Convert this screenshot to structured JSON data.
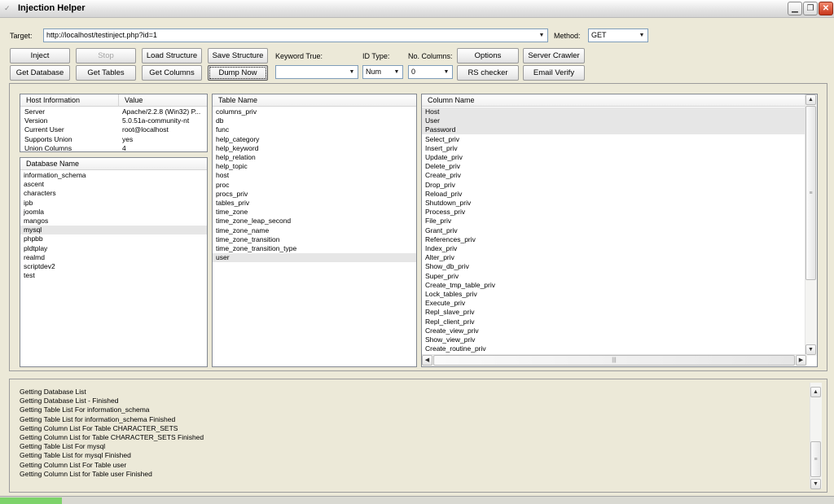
{
  "window": {
    "title": "Injection Helper"
  },
  "toolbar": {
    "target_label": "Target:",
    "target_value": "http://localhost/testinject.php?id=1",
    "method_label": "Method:",
    "method_value": "GET",
    "keyword_true_label": "Keyword True:",
    "keyword_true_value": "",
    "id_type_label": "ID Type:",
    "id_type_value": "Num",
    "no_columns_label": "No. Columns:",
    "no_columns_value": "0",
    "buttons": {
      "inject": "Inject",
      "stop": "Stop",
      "load_structure": "Load Structure",
      "save_structure": "Save Structure",
      "options": "Options",
      "server_crawler": "Server Crawler",
      "get_database": "Get Database",
      "get_tables": "Get Tables",
      "get_columns": "Get Columns",
      "dump_now": "Dump Now",
      "rs_checker": "RS checker",
      "email_verify": "Email Verify"
    }
  },
  "host_info": {
    "headers": [
      "Host Information",
      "Value"
    ],
    "rows": [
      {
        "key": "Server",
        "value": "Apache/2.2.8 (Win32) P..."
      },
      {
        "key": "Version",
        "value": "5.0.51a-community-nt"
      },
      {
        "key": "Current User",
        "value": "root@localhost"
      },
      {
        "key": "Supports Union",
        "value": "yes"
      },
      {
        "key": "Union Columns",
        "value": "4"
      }
    ]
  },
  "databases": {
    "header": "Database Name",
    "items": [
      "information_schema",
      "ascent",
      "characters",
      "ipb",
      "joomla",
      "mangos",
      "mysql",
      "phpbb",
      "pldtplay",
      "realmd",
      "scriptdev2",
      "test"
    ],
    "selected_index": 6
  },
  "tables": {
    "header": "Table Name",
    "items": [
      "columns_priv",
      "db",
      "func",
      "help_category",
      "help_keyword",
      "help_relation",
      "help_topic",
      "host",
      "proc",
      "procs_priv",
      "tables_priv",
      "time_zone",
      "time_zone_leap_second",
      "time_zone_name",
      "time_zone_transition",
      "time_zone_transition_type",
      "user"
    ],
    "selected_index": 16
  },
  "columns": {
    "header": "Column Name",
    "items": [
      "Host",
      "User",
      "Password",
      "Select_priv",
      "Insert_priv",
      "Update_priv",
      "Delete_priv",
      "Create_priv",
      "Drop_priv",
      "Reload_priv",
      "Shutdown_priv",
      "Process_priv",
      "File_priv",
      "Grant_priv",
      "References_priv",
      "Index_priv",
      "Alter_priv",
      "Show_db_priv",
      "Super_priv",
      "Create_tmp_table_priv",
      "Lock_tables_priv",
      "Execute_priv",
      "Repl_slave_priv",
      "Repl_client_priv",
      "Create_view_priv",
      "Show_view_priv",
      "Create_routine_priv"
    ],
    "selected_indices": [
      0,
      1,
      2
    ]
  },
  "log": {
    "lines": [
      "Getting Database List",
      "Getting Database List - Finished",
      "Getting Table List For information_schema",
      "Getting Table List for information_schema Finished",
      "Getting Column List For Table CHARACTER_SETS",
      "Getting Column List for Table CHARACTER_SETS Finished",
      "Getting Table List For mysql",
      "Getting Table List for mysql Finished",
      "Getting Column List For Table user",
      "Getting Column List for Table user Finished"
    ]
  },
  "icons": {
    "title": "app-icon",
    "minimize": "minimize-icon",
    "restore": "restore-icon",
    "close": "close-icon",
    "dropdown": "chevron-down-icon",
    "scroll_up": "chevron-up-icon",
    "scroll_down": "chevron-down-icon",
    "scroll_left": "chevron-left-icon",
    "scroll_right": "chevron-right-icon"
  },
  "colors": {
    "selection": "#e6e6e6",
    "status_progress": "#7dd36a",
    "close_button": "#c8361b"
  }
}
